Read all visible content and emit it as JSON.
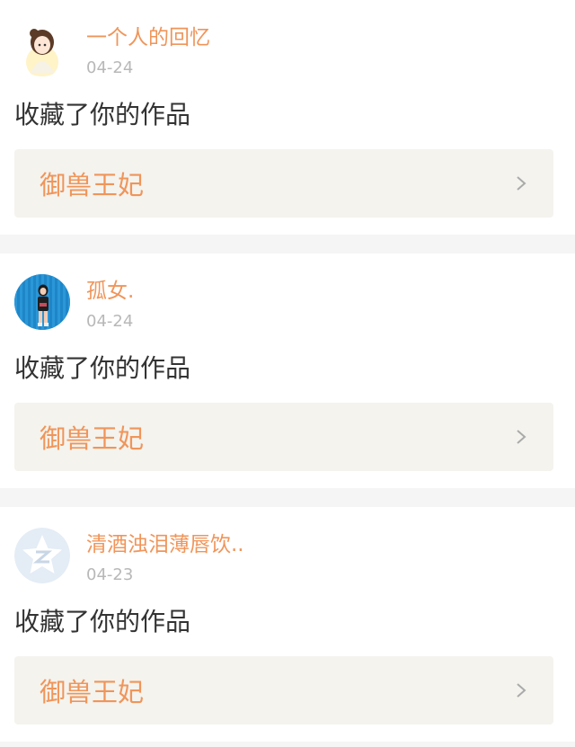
{
  "items": [
    {
      "username": "一个人的回忆",
      "time": "04-24",
      "action": "收藏了你的作品",
      "work_title": "御兽王妃",
      "avatar_icon": "avatar-illustrated-girl-icon"
    },
    {
      "username": "孤女.",
      "time": "04-24",
      "action": "收藏了你的作品",
      "work_title": "御兽王妃",
      "avatar_icon": "avatar-photo-girl-blue-wall-icon"
    },
    {
      "username": "清酒浊泪薄唇饮..",
      "time": "04-23",
      "action": "收藏了你的作品",
      "work_title": "御兽王妃",
      "avatar_icon": "avatar-default-qzone-icon"
    }
  ],
  "colors": {
    "accent": "#f0955a",
    "work_bg": "#f4f3ee",
    "divider_bg": "#f5f5f5",
    "timestamp": "#b8b8b8"
  }
}
